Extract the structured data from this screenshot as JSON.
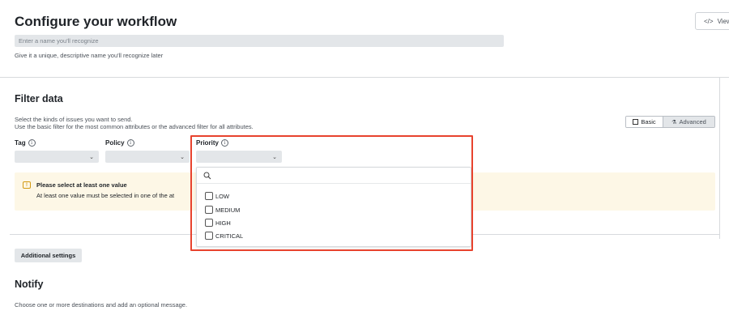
{
  "header": {
    "title": "Configure your workflow",
    "name_placeholder": "Enter a name you'll recognize",
    "name_help": "Give it a unique, descriptive name you'll recognize later",
    "view_button_label": "View"
  },
  "filter": {
    "title": "Filter data",
    "desc_line1": "Select the kinds of issues you want to send.",
    "desc_line2": "Use the basic filter for the most common attributes or the advanced filter for all attributes.",
    "mode_basic": "Basic",
    "mode_advanced": "Advanced",
    "fields": [
      {
        "label": "Tag"
      },
      {
        "label": "Policy"
      },
      {
        "label": "Priority"
      }
    ],
    "warning_title": "Please select at least one value",
    "warning_body": "At least one value must be selected in one of the at"
  },
  "priority_dropdown": {
    "options": [
      "LOW",
      "MEDIUM",
      "HIGH",
      "CRITICAL"
    ]
  },
  "additional_settings_label": "Additional settings",
  "notify": {
    "title": "Notify",
    "desc": "Choose one or more destinations and add an optional message."
  },
  "colors": {
    "highlight": "#e8432e",
    "warning_bg": "#fdf7e6",
    "warning_icon": "#d29a12"
  }
}
